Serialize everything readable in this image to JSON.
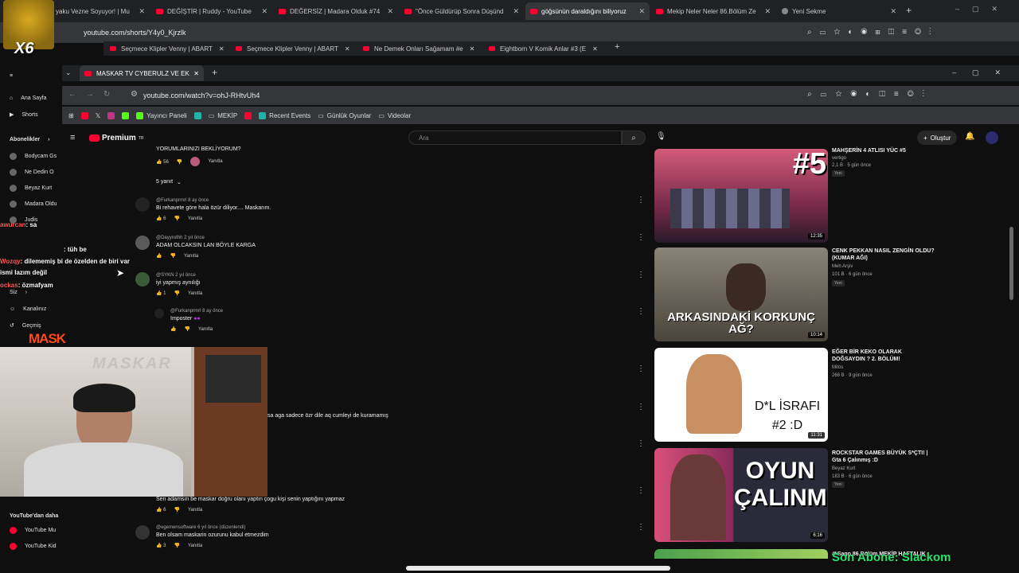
{
  "outer_tabs": [
    {
      "label": "yaku Vezne Soyuyor! | Mu"
    },
    {
      "label": "DEĞİŞTİR | Ruddy - YouTube"
    },
    {
      "label": "DEĞERSİZ | Madara Olduk #74"
    },
    {
      "label": "\"Önce Güldürüp Sonra Düşünd"
    },
    {
      "label": "göğsünün daraldığını biliyoruz"
    },
    {
      "label": "Mekip Neler Neler 86.Bölüm Ze"
    },
    {
      "label": "Yeni Sekme"
    }
  ],
  "outer_url": "youtube.com/shorts/Y4y0_Kjrzlk",
  "second_tabs": [
    {
      "label": "Seçmece Klipler Venny | ABART"
    },
    {
      "label": "Seçmece Klipler Venny | ABART"
    },
    {
      "label": "Ne Demek Onları Sağamam #e"
    },
    {
      "label": "Eightborn V Komik Anlar #3 (E"
    }
  ],
  "inner_tab": "MASKAR TV CYBERULZ VE EK",
  "inner_url": "youtube.com/watch?v=ohJ-RHtvUh4",
  "bookmarks": [
    "Yayıncı Paneli",
    "MEKİP",
    "Recent Events",
    "Günlük Oyunlar",
    "Videolar"
  ],
  "youtube": {
    "logo": "Premium",
    "logo_sup": "TR",
    "search_placeholder": "Ara",
    "create_label": "Oluştur"
  },
  "sidebar": {
    "home": "Ana Sayfa",
    "shorts": "Shorts",
    "subs_header": "Abonelikler",
    "subs": [
      "Bodycam Gs",
      "Ne Dedin O",
      "Beyaz Kurt",
      "Madara Oldu",
      "Judis"
    ],
    "you": "Siz",
    "channel": "Kanalınız",
    "history": "Geçmiş",
    "from_yt": "YouTube'dan daha",
    "yt_music": "YouTube Mu",
    "yt_kids": "YouTube Kid"
  },
  "comments": [
    {
      "user": "",
      "time": "",
      "text": "YORUMLARINIZI BEKLİYORUM?",
      "likes": "56",
      "reply": "Yanıtla"
    },
    {
      "user": "@Furkanprmrl",
      "time": "8 ay önce",
      "text": "Bi rehavete göre hala özür diliyor.... Maskarım.",
      "likes": "6",
      "reply": "Yanıtla"
    },
    {
      "user": "@Dayyrothh",
      "time": "2 yıl önce",
      "text": "ADAM OLCAKSIN LAN BÖYLE KARGA",
      "likes": "",
      "reply": "Yanıtla"
    },
    {
      "user": "@SYKN",
      "time": "2 yıl önce",
      "text": "iyi yapmış aynılığı",
      "likes": "1",
      "reply": "Yanıtla"
    },
    {
      "user": "@Furkanprmrl",
      "time": "8 ay önce",
      "text": "Imposter",
      "likes": "",
      "reply": "Yanıtla"
    },
    {
      "user": "",
      "time": "",
      "text": "sa aga sadece özr dile aq cumleyi de kuramamış",
      "likes": "",
      "reply": ""
    },
    {
      "user": "",
      "time": "",
      "text": "Sen adamsın be maskar doğru olanı yaptın çogu kişi senin yaptığını yapmaz",
      "likes": "6",
      "reply": "Yanıtla"
    },
    {
      "user": "@egemensoftware",
      "time": "6 yıl önce (düzenlendi)",
      "text": "Ben olsam maskarin ozurunu kabul etmezdim",
      "likes": "3",
      "reply": "Yanıtla"
    }
  ],
  "replies_toggle": "5 yanıt",
  "videos": [
    {
      "title": "MAHŞERİN 4 ATLISI YÜC #5",
      "channel": "vertigo",
      "meta": "2,1 B · 5 gün önce",
      "badge": "Yeni",
      "duration": "12:35",
      "overlay": "#5",
      "color": "#c64a6a"
    },
    {
      "title": "CENK PEKKAN NASIL ZENGİN OLDU? (KUMAR AĞI)",
      "channel": "Meh Arşiv",
      "meta": "101 B · 6 gün önce",
      "badge": "Yeni",
      "duration": "10:14",
      "overlay": "ARKASINDAKİ KORKUNÇ AĞ?",
      "color": "#6a6358"
    },
    {
      "title": "EĞER BİR KEKO OLARAK DOĞSAYDIN ? 2. BÖLÜM!",
      "channel": "Mitos",
      "meta": "268 B · 9 gün önce",
      "badge": "",
      "duration": "11:31",
      "overlay": "D*L İSRAFI #2 :D",
      "color": "#ffffff"
    },
    {
      "title": "ROCKSTAR GAMES BÜYÜK S*ÇTI! | Gta 6 Çalınmış :D",
      "channel": "Beyaz Kurt",
      "meta": "183 B · 6 gün önce",
      "badge": "Yeni",
      "duration": "6:16",
      "overlay": "OYUN ÇALINMIŞ",
      "color": "#c4406a"
    },
    {
      "title": "@Sago 86.Bölüm MEKİP HAFTALIK",
      "channel": "",
      "meta": "",
      "badge": "",
      "duration": "",
      "overlay": "",
      "color": "#3a7a3a"
    }
  ],
  "overlay": {
    "chat": [
      {
        "name": "awurcan",
        "text": ": sa"
      },
      {
        "name": "",
        "text": ": tüh be"
      },
      {
        "name": "Wozqy",
        "text": ": dilememiş bi de özelden de biri var"
      },
      {
        "name": "",
        "text": "ismi lazım değil"
      },
      {
        "name": "ockas",
        "text": ": özmafyam"
      }
    ],
    "mask_label": "MASK",
    "cam_wall_text": "MASKAR",
    "x6_label": "X6",
    "sub_label": "Son Abone: Slackom"
  },
  "colors": {
    "accent": "#ff0033",
    "sub_green": "#29e36a"
  }
}
